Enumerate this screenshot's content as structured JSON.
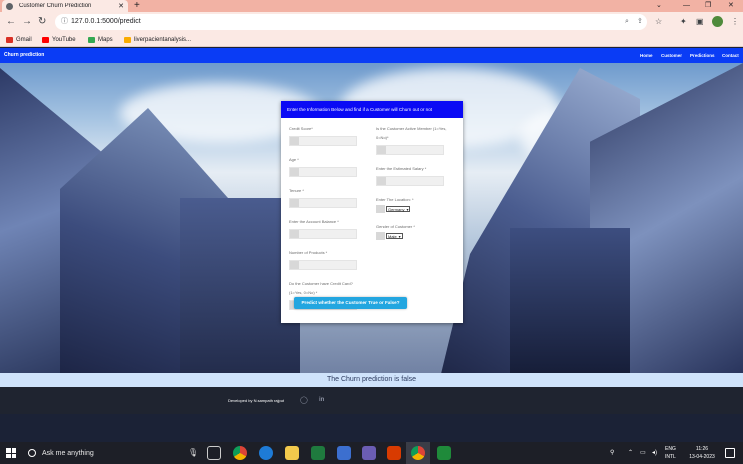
{
  "browser": {
    "tab_title": "Customer Churn Prediction",
    "url": "127.0.0.1:5000/predict",
    "bookmarks": [
      {
        "label": "Gmail",
        "color": "#d93025"
      },
      {
        "label": "YouTube",
        "color": "#ff0000"
      },
      {
        "label": "Maps",
        "color": "#34a853"
      },
      {
        "label": "liverpacientanalysis...",
        "color": "#f9ab00"
      }
    ]
  },
  "navbar": {
    "brand": "Churn prediction",
    "links": [
      "Home",
      "Customer",
      "Predictions",
      "Contact"
    ]
  },
  "form": {
    "header": "Enter the Information Below and find if a Customer will Churn out or not",
    "left_fields": [
      "Credit Score*",
      "Age *",
      "Tenure *",
      "Enter the Account Balance *",
      "Number of Products *"
    ],
    "credit_card_label_1": "Do the Customer have Credit Card?",
    "credit_card_label_2": "(1=Yes, 0=No) *",
    "active_member_label_1": "Is the Customer Active Member (1=Yes,",
    "active_member_label_2": "0=No)*",
    "salary_label": "Enter the Estimated Salary *",
    "location_label": "Enter The Location: *",
    "location_value": "Germany",
    "gender_label": "Gender of Customer *",
    "gender_value": "Male",
    "submit_label": "Predict whether the Customer True or False?"
  },
  "result": "The Churn prediction is false",
  "footer": {
    "credit": "Developed by N.sampath rajput"
  },
  "taskbar": {
    "search_placeholder": "Ask me anything",
    "lang_line1": "ENG",
    "lang_line2": "INTL",
    "time": "11:26",
    "date": "13-04-2023"
  }
}
